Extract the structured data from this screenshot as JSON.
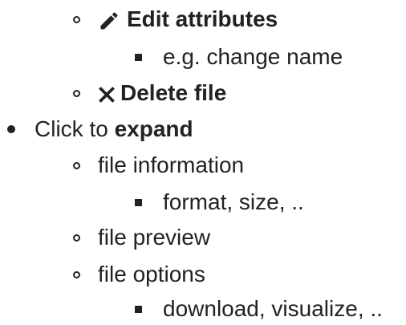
{
  "items": {
    "edit_attributes": {
      "icon": "pencil-icon",
      "label": "Edit attributes"
    },
    "edit_example": {
      "label": "e.g. change name"
    },
    "delete_file": {
      "icon": "close-icon",
      "label": "Delete file"
    },
    "click_to": {
      "prefix": "Click to ",
      "emphasis": "expand"
    },
    "file_information": {
      "label": "file information"
    },
    "file_information_detail": {
      "label": "format, size, .."
    },
    "file_preview": {
      "label": "file preview"
    },
    "file_options": {
      "label": "file options"
    },
    "file_options_detail": {
      "label": "download, visualize, .."
    }
  }
}
